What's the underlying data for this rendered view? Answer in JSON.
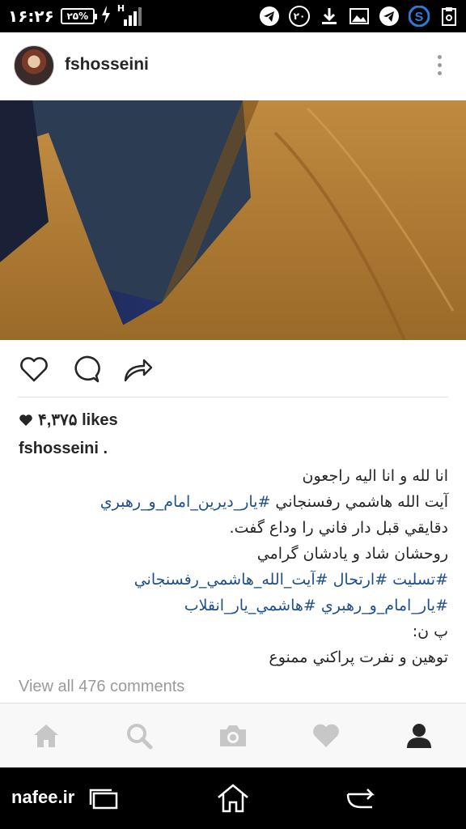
{
  "status_bar": {
    "time": "۱۶:۲۶",
    "battery": "۲۵%",
    "network": "H",
    "notification_badge": "۲۰",
    "icons": [
      "telegram-icon",
      "notification-20-icon",
      "download-icon",
      "gallery-icon",
      "telegram-icon",
      "skype-icon",
      "clipboard-icon"
    ]
  },
  "post": {
    "username": "fshosseini",
    "likes_count": "۴,۳۷۵ likes",
    "caption_username": "fshosseini .",
    "caption_lines": [
      {
        "text": "انا لله و انا اليه راجعون",
        "tag": false
      },
      {
        "text": "آيت الله هاشمي رفسنجاني ",
        "tag_text": "#يار_ديرين_امام_و_رهبري",
        "tag": "mixed"
      },
      {
        "text": "دقايقي قبل دار فاني را وداع گفت.",
        "tag": false
      },
      {
        "text": "روحشان شاد و يادشان گرامي",
        "tag": false
      },
      {
        "text": "#تسليت #ارتحال #آيت_الله_هاشمي_رفسنجاني",
        "tag": true
      },
      {
        "text": "#يار_امام_و_رهبري #هاشمي_يار_انقلاب",
        "tag": true
      },
      {
        "text": "پ ن:",
        "tag": false
      },
      {
        "text": "توهين و نفرت پراكني ممنوع",
        "tag": false
      }
    ],
    "view_comments": "View all 476 comments"
  },
  "tabs": [
    "home-icon",
    "search-icon",
    "camera-icon",
    "activity-heart-icon",
    "profile-icon"
  ],
  "watermark": "nafee.ir",
  "colors": {
    "hashtag": "#1e4f8c",
    "text": "#262626",
    "muted": "#9a9a9a",
    "tab_inactive": "#c7c7c7",
    "tab_active": "#262626"
  }
}
